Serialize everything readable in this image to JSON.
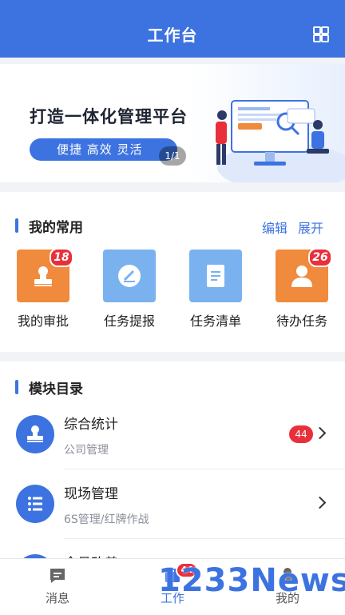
{
  "header": {
    "title": "工作台"
  },
  "banner": {
    "headline": "打造一体化管理平台",
    "slogan": "便捷  高效  灵活",
    "pager": "1/1"
  },
  "favorites": {
    "title": "我的常用",
    "edit_label": "编辑",
    "expand_label": "展开",
    "items": [
      {
        "label": "我的审批",
        "badge": "18",
        "color": "#f08a3c"
      },
      {
        "label": "任务提报",
        "badge": "",
        "color": "#7ab2f0"
      },
      {
        "label": "任务清单",
        "badge": "",
        "color": "#7ab2f0"
      },
      {
        "label": "待办任务",
        "badge": "26",
        "color": "#f08a3c"
      }
    ]
  },
  "modules": {
    "title": "模块目录",
    "items": [
      {
        "title": "综合统计",
        "subtitle": "公司管理",
        "count": "44"
      },
      {
        "title": "现场管理",
        "subtitle": "6S管理/红牌作战",
        "count": ""
      },
      {
        "title": "全员改善",
        "subtitle": "",
        "count": ""
      }
    ]
  },
  "tabbar": {
    "tabs": [
      {
        "label": "消息",
        "active": false
      },
      {
        "label": "工作",
        "active": true,
        "badge": "44"
      },
      {
        "label": "我的",
        "active": false
      }
    ]
  },
  "watermark": "1233News",
  "colors": {
    "primary": "#3d73e0",
    "orange": "#f08a3c",
    "badge": "#e8303a"
  }
}
